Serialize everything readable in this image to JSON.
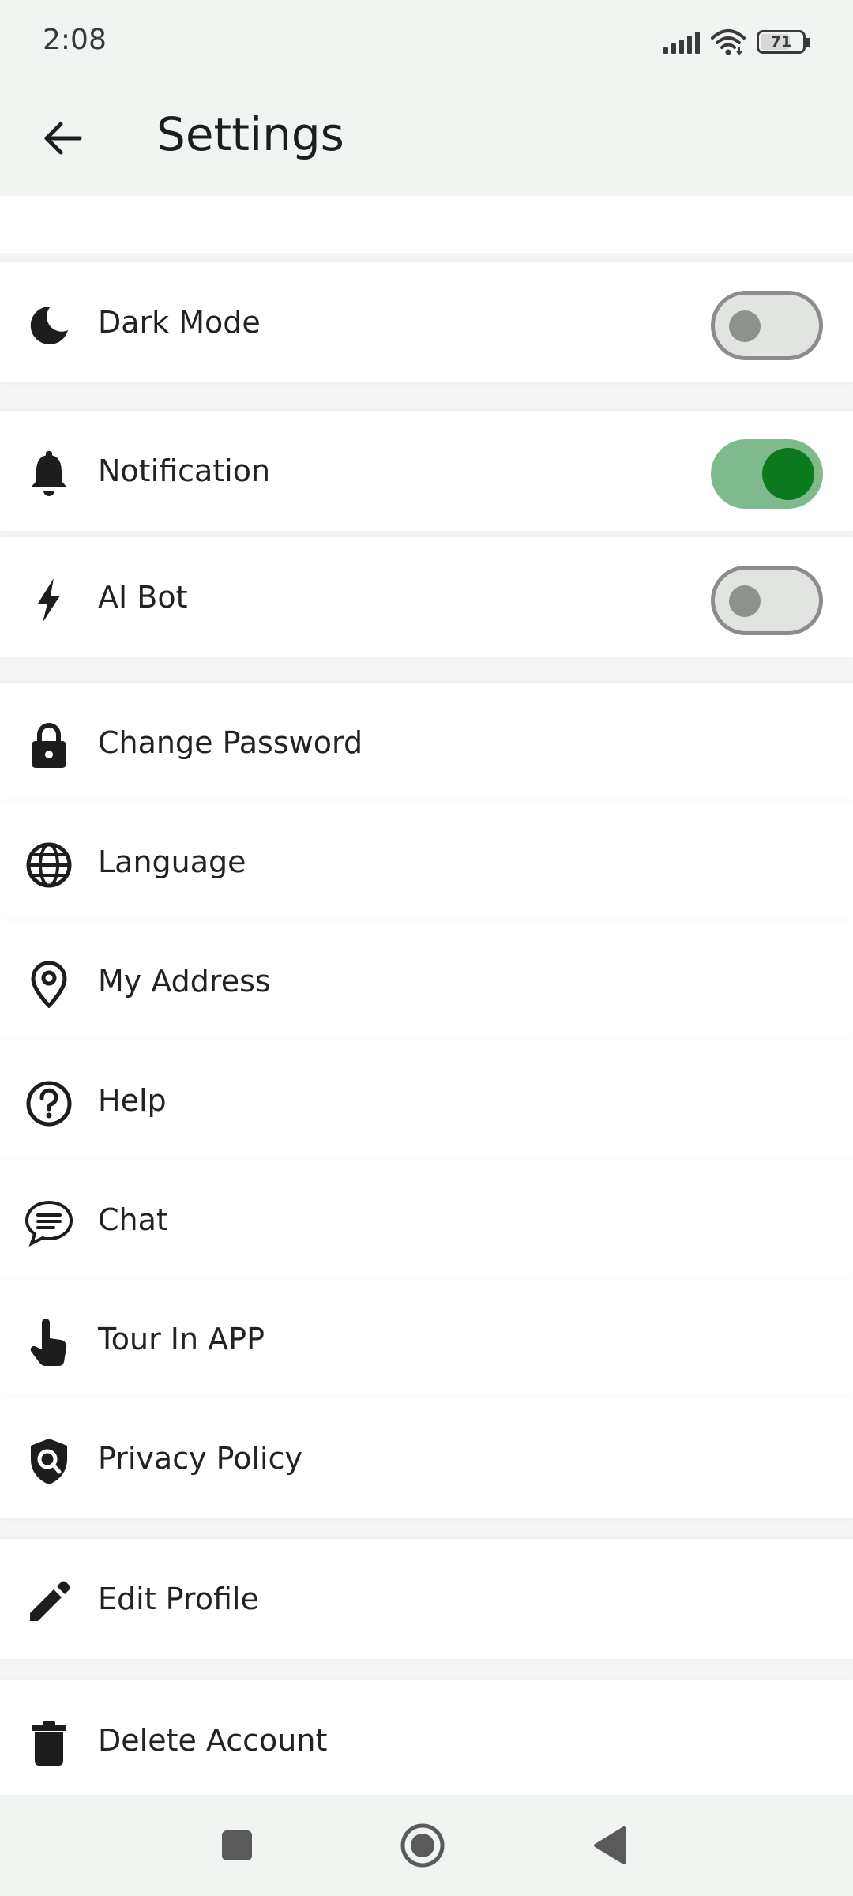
{
  "status_bar": {
    "time": "2:08",
    "battery": "71",
    "battery_level_percent": 71
  },
  "app_bar": {
    "title": "Settings",
    "back_icon": "arrow-back-icon"
  },
  "settings": [
    {
      "label": "Dark Mode",
      "icon": "moon-icon",
      "toggle": "off"
    },
    {
      "label": "Notification",
      "icon": "bell-icon",
      "toggle": "on"
    },
    {
      "label": "AI Bot",
      "icon": "lightning-icon",
      "toggle": "off"
    },
    {
      "label": "Change Password",
      "icon": "lock-icon"
    },
    {
      "label": "Language",
      "icon": "globe-icon"
    },
    {
      "label": "My Address",
      "icon": "location-pin-icon"
    },
    {
      "label": "Help",
      "icon": "help-circle-icon"
    },
    {
      "label": "Chat",
      "icon": "chat-bubble-icon"
    },
    {
      "label": "Tour In APP",
      "icon": "touch-hand-icon"
    },
    {
      "label": "Privacy Policy",
      "icon": "shield-search-icon"
    },
    {
      "label": "Edit Profile",
      "icon": "pencil-icon"
    },
    {
      "label": "Delete Account",
      "icon": "trash-icon"
    }
  ],
  "nav_bar": {
    "buttons": [
      "recent-apps-icon",
      "home-icon",
      "back-triangle-icon"
    ]
  },
  "colors": {
    "accent": "#0b7a1e",
    "toggle_on_track": "#7fba8c",
    "bar_bg": "#f0f5f1"
  }
}
